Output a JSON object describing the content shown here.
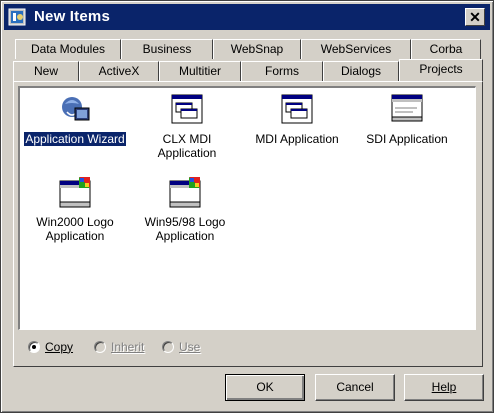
{
  "window": {
    "title": "New Items"
  },
  "tabs": {
    "back_row": [
      "Data Modules",
      "Business",
      "WebSnap",
      "WebServices",
      "Corba"
    ],
    "front_row": [
      "New",
      "ActiveX",
      "Multitier",
      "Forms",
      "Dialogs",
      "Projects"
    ],
    "active": "Projects"
  },
  "items": [
    {
      "label_lines": [
        "Application Wizard"
      ],
      "icon": "wizard-icon",
      "selected": true
    },
    {
      "label_lines": [
        "CLX MDI",
        "Application"
      ],
      "icon": "mdi-app-icon",
      "selected": false
    },
    {
      "label_lines": [
        "MDI Application"
      ],
      "icon": "mdi-app-icon",
      "selected": false
    },
    {
      "label_lines": [
        "SDI Application"
      ],
      "icon": "sdi-app-icon",
      "selected": false
    },
    {
      "label_lines": [
        "Win2000 Logo",
        "Application"
      ],
      "icon": "logo-app-icon",
      "selected": false
    },
    {
      "label_lines": [
        "Win95/98 Logo",
        "Application"
      ],
      "icon": "logo-app-icon",
      "selected": false
    }
  ],
  "mode": {
    "copy": "Copy",
    "inherit": "Inherit",
    "use": "Use",
    "selected": "copy"
  },
  "buttons": {
    "ok": "OK",
    "cancel": "Cancel",
    "help": "Help"
  },
  "colors": {
    "titlebar": "#0a246a",
    "selection": "#0a246a",
    "face": "#d4d0c8"
  }
}
